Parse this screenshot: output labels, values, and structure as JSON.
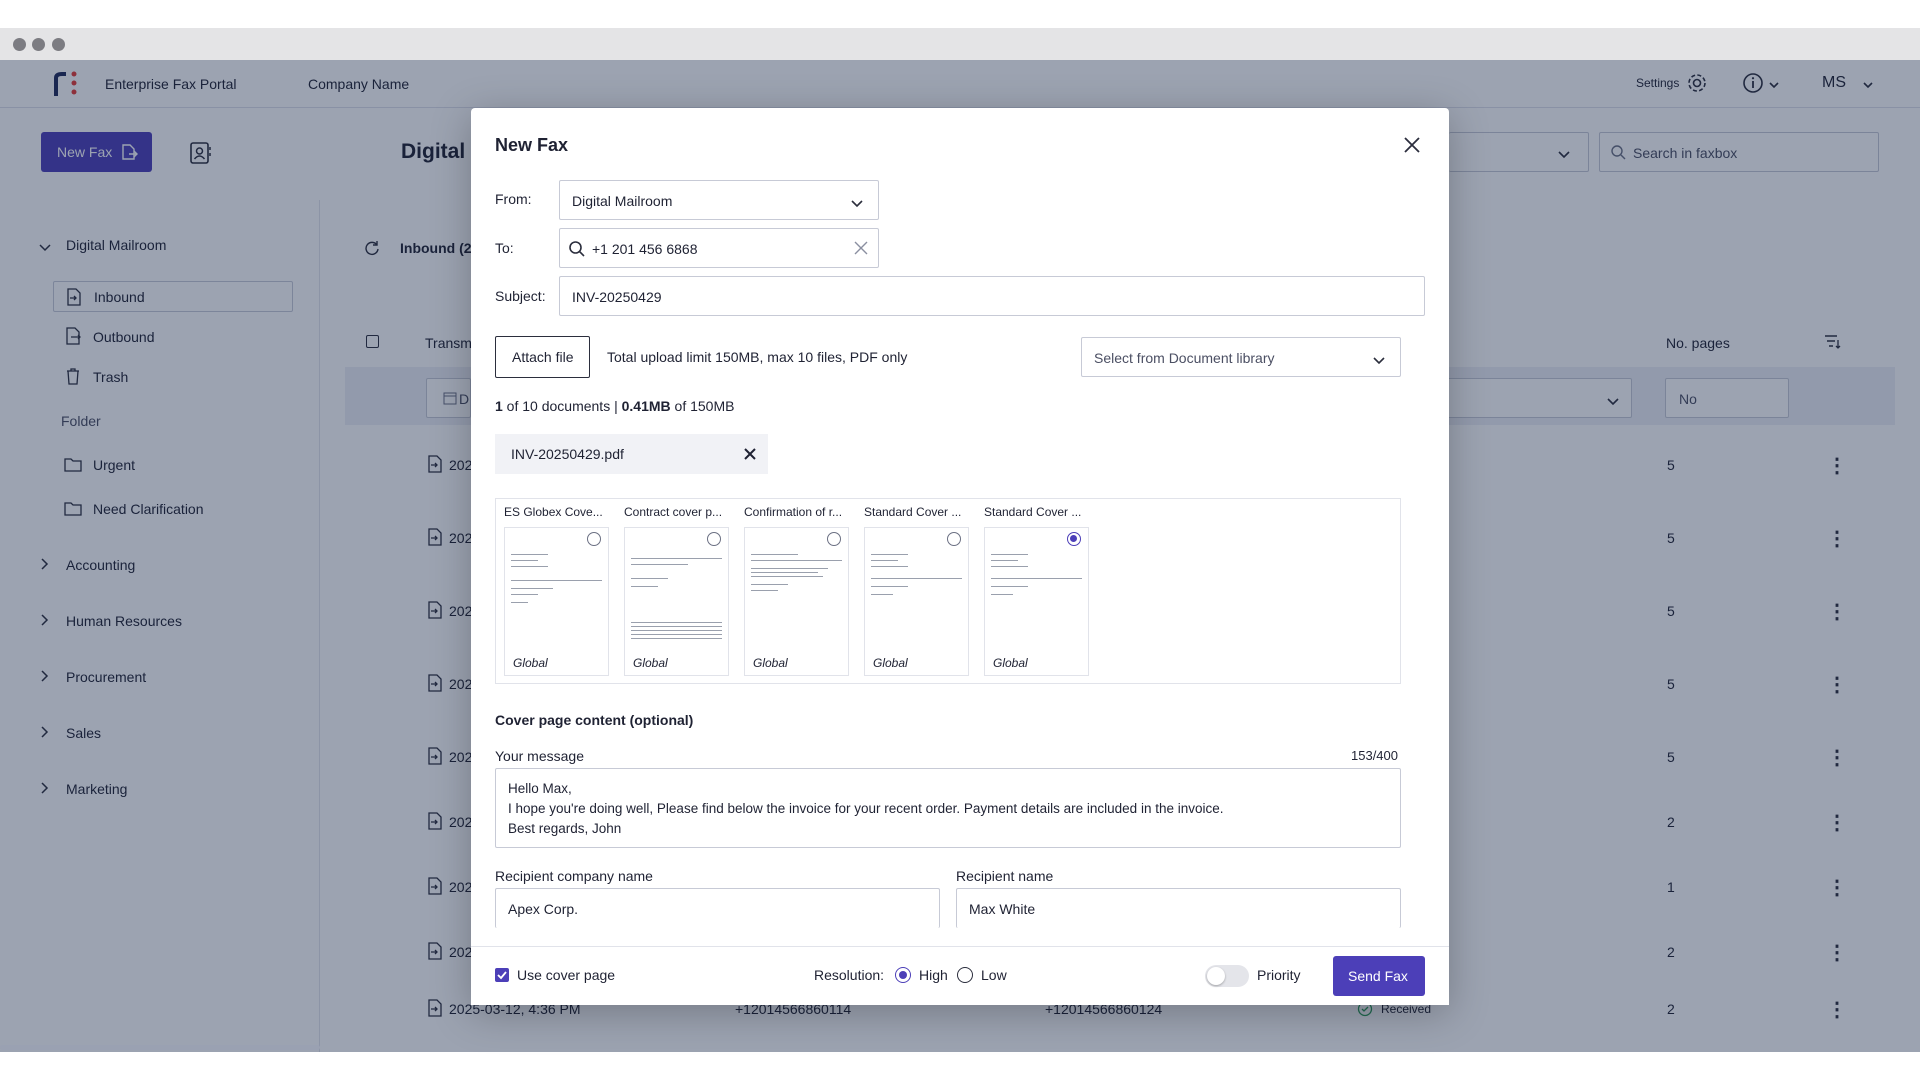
{
  "app": {
    "brand": "Enterprise Fax Portal",
    "company": "Company Name",
    "settings_label": "Settings",
    "user_initials": "MS",
    "new_fax_label": "New Fax",
    "page_title": "Digital I",
    "search_placeholder": "Search in faxbox",
    "accent": "#4c3fb8"
  },
  "sidebar": {
    "root": "Digital Mailroom",
    "items": [
      "Inbound",
      "Outbound",
      "Trash"
    ],
    "folder_heading": "Folder",
    "folders": [
      "Urgent",
      "Need Clarification"
    ],
    "groups": [
      "Accounting",
      "Human Resources",
      "Procurement",
      "Sales",
      "Marketing"
    ]
  },
  "list": {
    "tab_label": "Inbound (2",
    "col_transm": "Transm",
    "col_pages": "No. pages",
    "filter_pages_placeholder": "No",
    "filter_date_stub": "D",
    "rows": [
      {
        "date": "202",
        "pages": "5"
      },
      {
        "date": "202",
        "pages": "5"
      },
      {
        "date": "202",
        "pages": "5"
      },
      {
        "date": "202",
        "pages": "5"
      },
      {
        "date": "202",
        "pages": "5"
      },
      {
        "date": "202",
        "pages": "2"
      },
      {
        "date": "202",
        "pages": "1"
      },
      {
        "date": "202",
        "pages": "2"
      }
    ],
    "last_row": {
      "date": "2025-03-12, 4:36 PM",
      "from": "+12014566860114",
      "to": "+12014566860124",
      "status": "Received",
      "pages": "2"
    }
  },
  "modal": {
    "title": "New Fax",
    "from_label": "From:",
    "from_value": "Digital Mailroom",
    "to_label": "To:",
    "to_value": "+1 201 456 6868",
    "subject_label": "Subject:",
    "subject_value": "INV-20250429",
    "attach_label": "Attach file",
    "upload_info": "Total upload limit 150MB, max 10 files, PDF only",
    "library_placeholder": "Select from Document library",
    "docs_count": "1",
    "docs_of": " of 10 documents | ",
    "docs_size": "0.41MB",
    "docs_limit": " of 150MB",
    "file_name": "INV-20250429.pdf",
    "covers": [
      {
        "title": "ES Globex Cove...",
        "tag": "Global",
        "selected": false
      },
      {
        "title": "Contract cover p...",
        "tag": "Global",
        "selected": false
      },
      {
        "title": "Confirmation of r...",
        "tag": "Global",
        "selected": false
      },
      {
        "title": "Standard Cover ...",
        "tag": "Global",
        "selected": false
      },
      {
        "title": "Standard Cover ...",
        "tag": "Global",
        "selected": true
      }
    ],
    "cover_section": "Cover page content (optional)",
    "message_label": "Your message",
    "message_count": "153/400",
    "message_lines": [
      "Hello Max,",
      "I hope you're doing well, Please find below the invoice for your recent order. Payment details are included in the invoice.",
      "Best regards, John"
    ],
    "company_label": "Recipient company name",
    "company_value": "Apex Corp.",
    "recipient_label": "Recipient name",
    "recipient_value": "Max White",
    "use_cover_label": "Use cover page",
    "use_cover_checked": true,
    "resolution_label": "Resolution:",
    "res_high": "High",
    "res_low": "Low",
    "resolution_selected": "High",
    "priority_label": "Priority",
    "priority_on": false,
    "send_label": "Send Fax"
  }
}
